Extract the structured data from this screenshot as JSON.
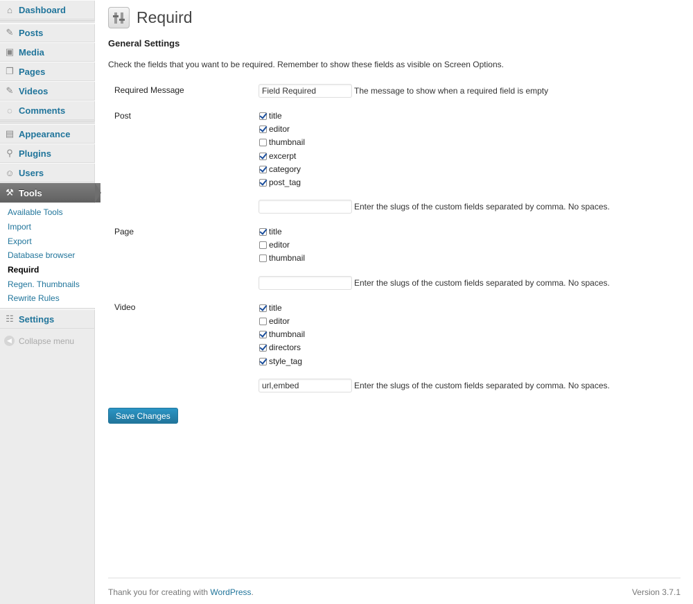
{
  "sidebar": {
    "menu": [
      {
        "label": "Dashboard",
        "icon": "dashboard-icon"
      },
      {
        "label": "Posts",
        "icon": "pin-icon"
      },
      {
        "label": "Media",
        "icon": "media-icon"
      },
      {
        "label": "Pages",
        "icon": "pages-icon"
      },
      {
        "label": "Videos",
        "icon": "pin-icon"
      },
      {
        "label": "Comments",
        "icon": "comment-icon"
      },
      {
        "label": "Appearance",
        "icon": "appearance-icon"
      },
      {
        "label": "Plugins",
        "icon": "plugin-icon"
      },
      {
        "label": "Users",
        "icon": "users-icon"
      },
      {
        "label": "Tools",
        "icon": "tools-icon"
      },
      {
        "label": "Settings",
        "icon": "settings-icon"
      }
    ],
    "tools_submenu": [
      "Available Tools",
      "Import",
      "Export",
      "Database browser",
      "Requird",
      "Regen. Thumbnails",
      "Rewrite Rules"
    ],
    "collapse_label": "Collapse menu"
  },
  "page": {
    "title": "Requird",
    "section_title": "General Settings",
    "intro": "Check the fields that you want to be required. Remember to show these fields as visible on Screen Options."
  },
  "form": {
    "required_message": {
      "label": "Required Message",
      "value": "Field Required",
      "description": "The message to show when a required field is empty"
    },
    "custom_fields_description": "Enter the slugs of the custom fields separated by comma. No spaces.",
    "post": {
      "label": "Post",
      "fields": [
        {
          "name": "title",
          "checked": true
        },
        {
          "name": "editor",
          "checked": true
        },
        {
          "name": "thumbnail",
          "checked": false
        },
        {
          "name": "excerpt",
          "checked": true
        },
        {
          "name": "category",
          "checked": true
        },
        {
          "name": "post_tag",
          "checked": true
        }
      ],
      "custom_fields": ""
    },
    "page": {
      "label": "Page",
      "fields": [
        {
          "name": "title",
          "checked": true
        },
        {
          "name": "editor",
          "checked": false
        },
        {
          "name": "thumbnail",
          "checked": false
        }
      ],
      "custom_fields": ""
    },
    "video": {
      "label": "Video",
      "fields": [
        {
          "name": "title",
          "checked": true
        },
        {
          "name": "editor",
          "checked": false
        },
        {
          "name": "thumbnail",
          "checked": true
        },
        {
          "name": "directors",
          "checked": true
        },
        {
          "name": "style_tag",
          "checked": true
        }
      ],
      "custom_fields": "url,embed"
    },
    "save_label": "Save Changes"
  },
  "footer": {
    "thanks_prefix": "Thank you for creating with ",
    "thanks_link": "WordPress",
    "thanks_suffix": ".",
    "version": "Version 3.7.1"
  },
  "colors": {
    "link": "#21759b",
    "active_menu": "#6e6e6e",
    "button": "#21759b"
  }
}
